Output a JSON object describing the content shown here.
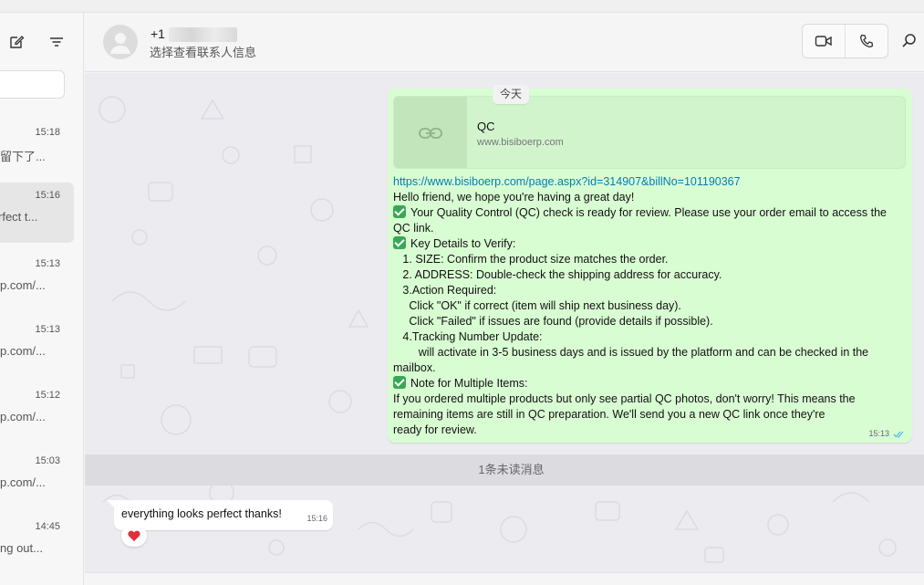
{
  "sidebar": {
    "chats": [
      {
        "time": "15:18",
        "preview": "留下了..."
      },
      {
        "time": "15:16",
        "preview": "rfect t..."
      },
      {
        "time": "15:13",
        "preview": "p.com/..."
      },
      {
        "time": "15:13",
        "preview": "p.com/..."
      },
      {
        "time": "15:12",
        "preview": "p.com/..."
      },
      {
        "time": "15:03",
        "preview": "p.com/..."
      },
      {
        "time": "14:45",
        "preview": "ng out..."
      }
    ]
  },
  "header": {
    "contact_name": "+1",
    "contact_subtitle": "选择查看联系人信息"
  },
  "conversation": {
    "date_divider": "今天",
    "outgoing": {
      "link_preview": {
        "title": "QC",
        "domain": "www.bisiboerp.com"
      },
      "url": "https://www.bisiboerp.com/page.aspx?id=314907&billNo=101190367",
      "lines": [
        "Hello friend, we hope you're having a great day!",
        "Your Quality Control (QC) check is ready for review. Please use your order email to access the",
        "QC link.",
        "Key Details to Verify:",
        "   1. SIZE: Confirm the product size matches the order.",
        "   2. ADDRESS: Double-check the shipping address for accuracy.",
        "   3.Action Required:",
        "     Click \"OK\" if correct (item will ship next business day).",
        "     Click \"Failed\" if issues are found (provide details if possible).",
        "   4.Tracking Number Update:",
        "        will activate in 3-5 business days and is issued by the platform and can be checked in the",
        "mailbox.",
        "Note for Multiple Items:",
        "If you ordered multiple products but only see partial QC photos, don't worry! This means the",
        "remaining items are still in QC preparation. We'll send you a new QC link once they're",
        "ready for review."
      ],
      "time": "15:13"
    },
    "unread_divider": "1条未读消息",
    "incoming": {
      "text": "everything looks perfect thanks!",
      "time": "15:16",
      "reaction": "heart"
    }
  },
  "colors": {
    "outgoing_bubble": "#d9fdd3",
    "link": "#027eb5",
    "chat_background": "#ecebf0",
    "read_ticks": "#53bdeb",
    "check_emoji": "#3aa757",
    "heart": "#e0303a"
  },
  "icons": {
    "new_chat": "new-chat-icon",
    "filter": "filter-icon",
    "video_call": "video-call-icon",
    "voice_call": "phone-icon",
    "search": "search-icon",
    "link": "link-icon",
    "read_receipt": "double-check-icon"
  }
}
